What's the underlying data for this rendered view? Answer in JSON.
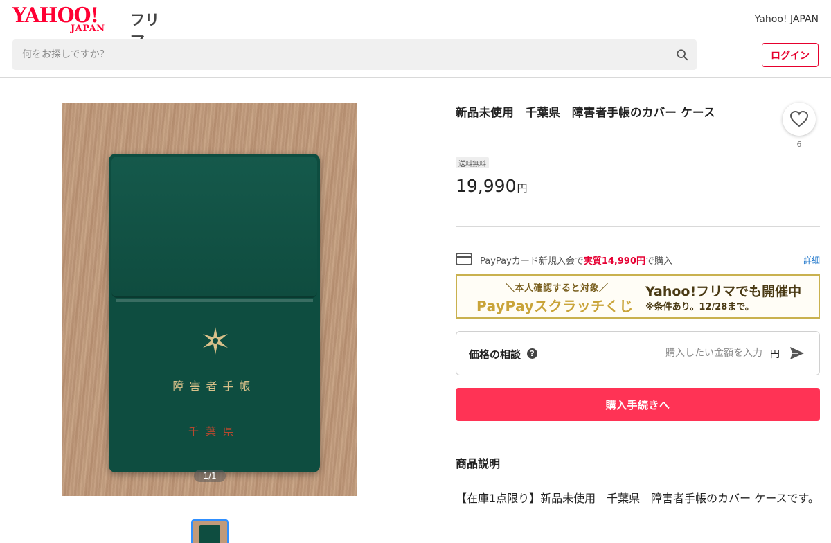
{
  "header": {
    "logo_text": "YAHOO!",
    "logo_sub": "JAPAN",
    "service_name": "フリマ",
    "yahoo_japan_link": "Yahoo! JAPAN",
    "search_placeholder": "何をお探しですか？",
    "login_label": "ログイン"
  },
  "gallery": {
    "book_title": "障害者手帳",
    "book_prefecture": "千葉県",
    "counter": "1/1"
  },
  "item": {
    "title": "新品未使用　千葉県　障害者手帳のカバー ケース",
    "like_count": "6",
    "shipping_badge": "送料無料",
    "price": "19,990",
    "price_unit": "円"
  },
  "paypay": {
    "text_before": "PayPayカード新規入会で",
    "text_highlight": "実質14,990円",
    "text_after": "で購入",
    "detail_link": "詳細"
  },
  "banner": {
    "subline": "＼本人確認すると対象／",
    "main": "PayPayスクラッチくじ",
    "right_title": "Yahoo!フリマでも開催中",
    "right_note": "※条件あり。12/28まで。"
  },
  "negotiation": {
    "label": "価格の相談",
    "help": "?",
    "input_placeholder": "購入したい金額を入力",
    "unit": "円"
  },
  "buy_button": "購入手続きへ",
  "description": {
    "heading": "商品説明",
    "body": "【在庫1点限り】新品未使用　千葉県　障害者手帳のカバー ケースです。"
  },
  "colors": {
    "brand_red": "#ff0033",
    "buy_button": "#ff3355",
    "link_blue": "#1a73c9",
    "banner_gold": "#c9b14f"
  },
  "icons": {
    "search": "search-icon",
    "heart": "heart-icon",
    "credit_card": "credit-card-icon",
    "help": "help-icon",
    "send": "send-icon"
  }
}
